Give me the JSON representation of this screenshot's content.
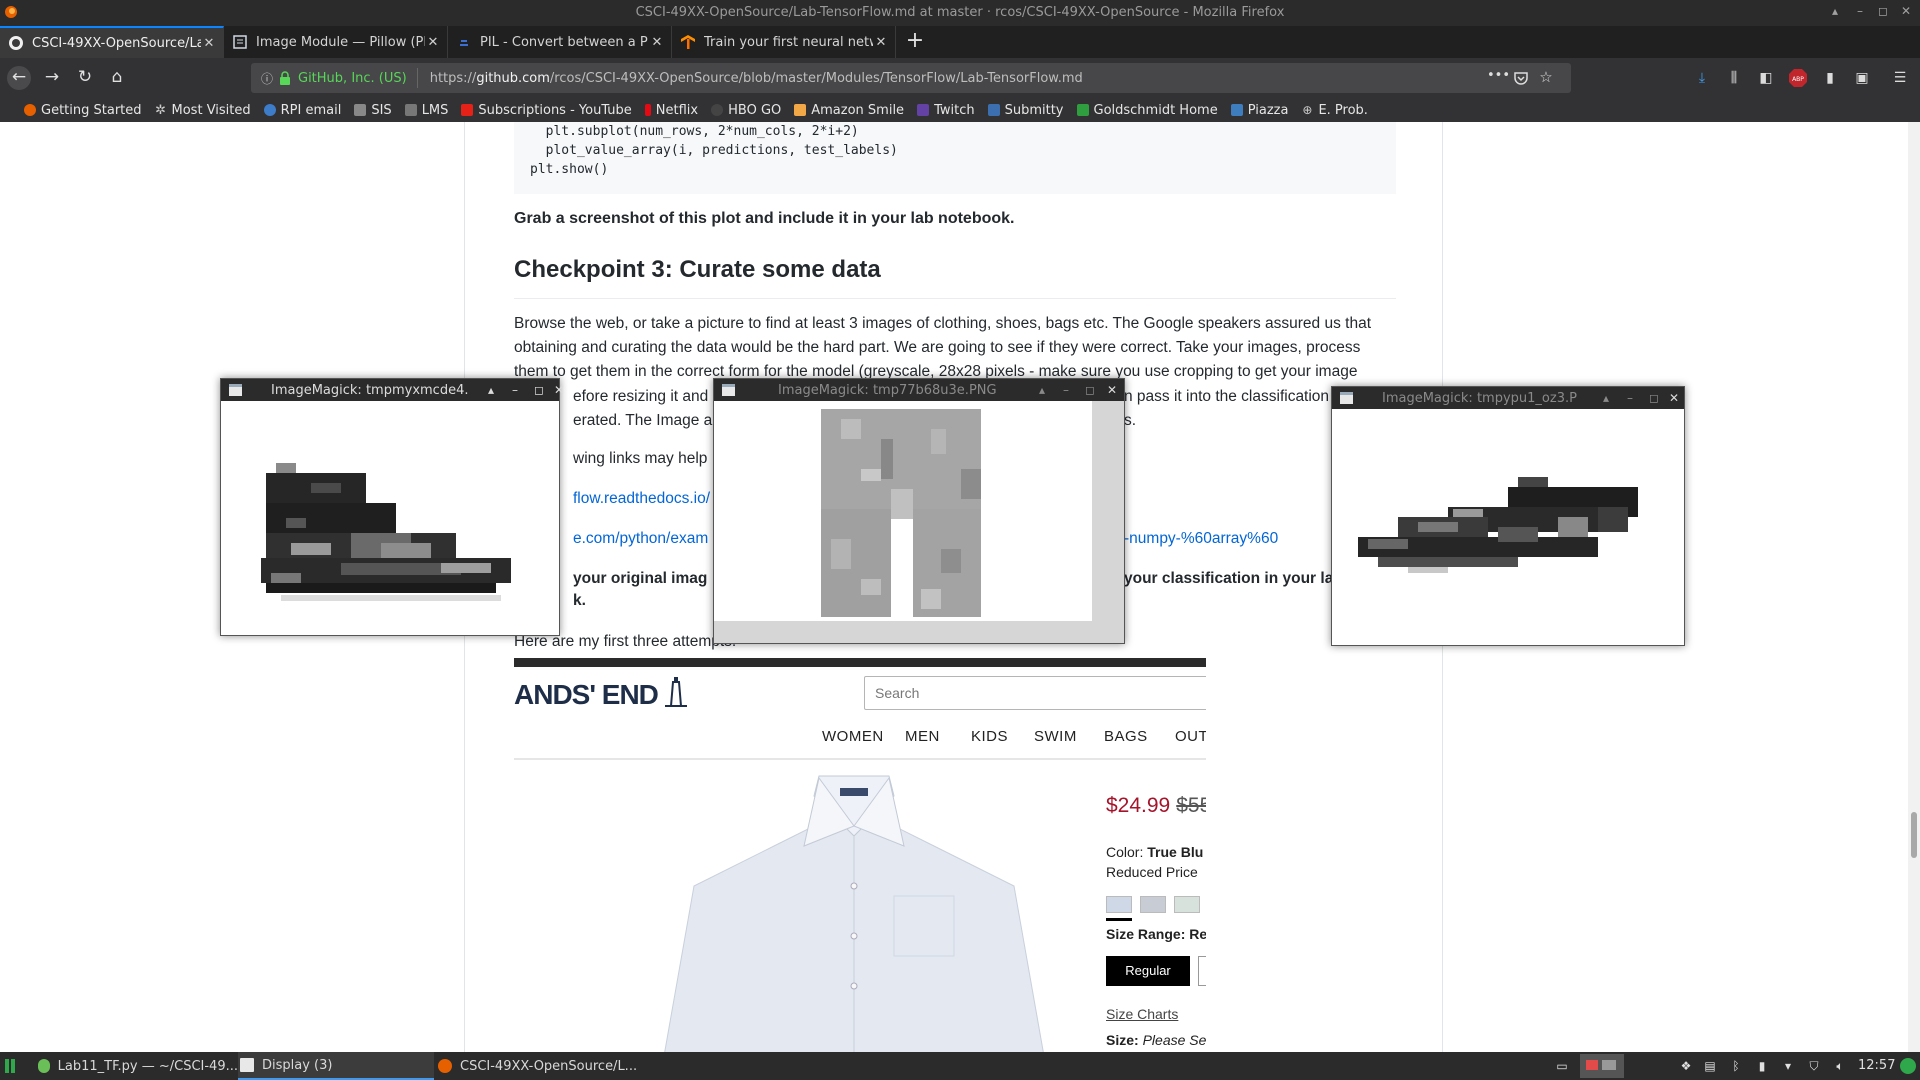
{
  "window": {
    "title": "CSCI-49XX-OpenSource/Lab-TensorFlow.md at master · rcos/CSCI-49XX-OpenSource - Mozilla Firefox"
  },
  "tabs": [
    {
      "label": "CSCI-49XX-OpenSource/La",
      "favicon": "github-icon",
      "active": true
    },
    {
      "label": "Image Module — Pillow (PI",
      "favicon": "doc-icon",
      "active": false
    },
    {
      "label": "PIL - Convert between a PI",
      "favicon": "stackoverflow-icon",
      "active": false
    },
    {
      "label": "Train your first neural netw",
      "favicon": "tensorflow-icon",
      "active": false
    }
  ],
  "navbar": {
    "identity": "GitHub, Inc. (US)",
    "url_prefix": "https://",
    "url_domain": "github.com",
    "url_path": "/rcos/CSCI-49XX-OpenSource/blob/master/Modules/TensorFlow/Lab-TensorFlow.md",
    "overflow": "•••"
  },
  "bookmarks": [
    {
      "label": "Getting Started",
      "color": "#e66000"
    },
    {
      "label": "Most Visited",
      "color": "#bbbbbb"
    },
    {
      "label": "RPI email",
      "color": "#3d7cc9"
    },
    {
      "label": "SIS",
      "color": "#888888"
    },
    {
      "label": "LMS",
      "color": "#777777"
    },
    {
      "label": "Subscriptions - YouTube",
      "color": "#e62117"
    },
    {
      "label": "Netflix",
      "color": "#e50914"
    },
    {
      "label": "HBO GO",
      "color": "#444444"
    },
    {
      "label": "Amazon Smile",
      "color": "#f3a847"
    },
    {
      "label": "Twitch",
      "color": "#6441a4"
    },
    {
      "label": "Submitty",
      "color": "#3c6fb0"
    },
    {
      "label": "Goldschmidt Home",
      "color": "#2e9e3f"
    },
    {
      "label": "Piazza",
      "color": "#3e7ebe"
    },
    {
      "label": "E. Prob.",
      "color": "#bbbbbb"
    }
  ],
  "article": {
    "code_lines": [
      "  plt.subplot(num_rows, 2*num_cols, 2*i+2)",
      "  plot_value_array(i, predictions, test_labels)",
      "plt.show()"
    ],
    "bold_note": "Grab a screenshot of this plot and include it in your lab notebook.",
    "heading": "Checkpoint 3: Curate some data",
    "para_line1": "Browse the web, or take a picture to find at least 3 images of clothing, shoes, bags etc. The Google speakers assured us that",
    "para_line2": "obtaining and curating the data would be the hard part. We are going to see if they were correct. Take your images, process",
    "para_line3": "them to get them in the correct form for the model (greyscale, 28x28 pixels - make sure you use cropping to get your image",
    "frag1": "efore resizing it and",
    "frag2": "n pass it into the classification",
    "frag3": "erated. The Image a",
    "frag4": "s.",
    "frag5": "wing links may help",
    "link1": "flow.readthedocs.io/",
    "link2a": "e.com/python/exam",
    "link2b": "-numpy-%60array%60",
    "bold_a": "your original imag",
    "bold_b": "your classification in your la",
    "bold_c": "k.",
    "attempts": "Here are my first three attempts:"
  },
  "shop": {
    "logo": "ANDS' END",
    "search_placeholder": "Search",
    "nav": [
      "WOMEN",
      "MEN",
      "KIDS",
      "SWIM",
      "BAGS",
      "OUTE"
    ],
    "price": "$24.99",
    "old_price": "$55",
    "color_label": "Color:",
    "color_value": "True Blu",
    "reduced": "Reduced Price",
    "swatches": [
      "#cfd8e6",
      "#c8ccd4",
      "#d8e2dc"
    ],
    "size_range_label": "Size Range:",
    "size_range_value": "Reg",
    "regular_btn": "Regular",
    "size_charts": "Size Charts",
    "size_label": "Size:",
    "size_value": "Please Se"
  },
  "imagemagick_windows": [
    {
      "title": "ImageMagick: tmpmyxmcde4.",
      "active": true
    },
    {
      "title": "ImageMagick: tmp77b68u3e.PNG",
      "active": false
    },
    {
      "title": "ImageMagick: tmpypu1_oz3.P",
      "active": false
    }
  ],
  "taskbar": {
    "items": [
      "Lab11_TF.py — ~/CSCI-49...",
      "Display (3)",
      "CSCI-49XX-OpenSource/L..."
    ],
    "clock": "12:57"
  }
}
